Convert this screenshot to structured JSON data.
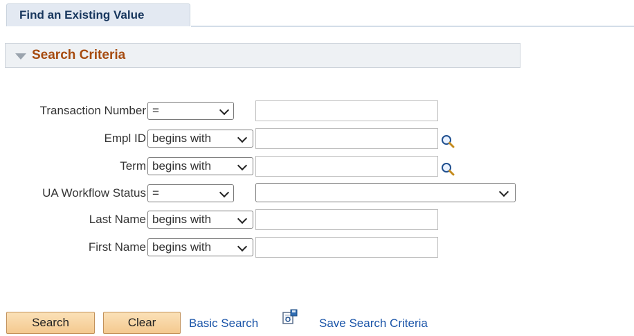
{
  "tab": {
    "label": "Find an Existing Value"
  },
  "criteria": {
    "title": "Search Criteria"
  },
  "fields": {
    "transaction_number": {
      "label": "Transaction Number",
      "operator": "=",
      "value": ""
    },
    "empl_id": {
      "label": "Empl ID",
      "operator": "begins with",
      "value": ""
    },
    "term": {
      "label": "Term",
      "operator": "begins with",
      "value": ""
    },
    "workflow_status": {
      "label": "UA Workflow Status",
      "operator": "=",
      "value": ""
    },
    "last_name": {
      "label": "Last Name",
      "operator": "begins with",
      "value": ""
    },
    "first_name": {
      "label": "First Name",
      "operator": "begins with",
      "value": ""
    }
  },
  "actions": {
    "search": "Search",
    "clear": "Clear",
    "basic_search": "Basic Search",
    "save_criteria": "Save Search Criteria"
  },
  "icons": [
    "chevron-down-icon",
    "magnifier-icon",
    "save-search-icon"
  ],
  "colors": {
    "section_title": "#a64b0f",
    "link": "#1a54a8",
    "button": "#f4c98f"
  }
}
